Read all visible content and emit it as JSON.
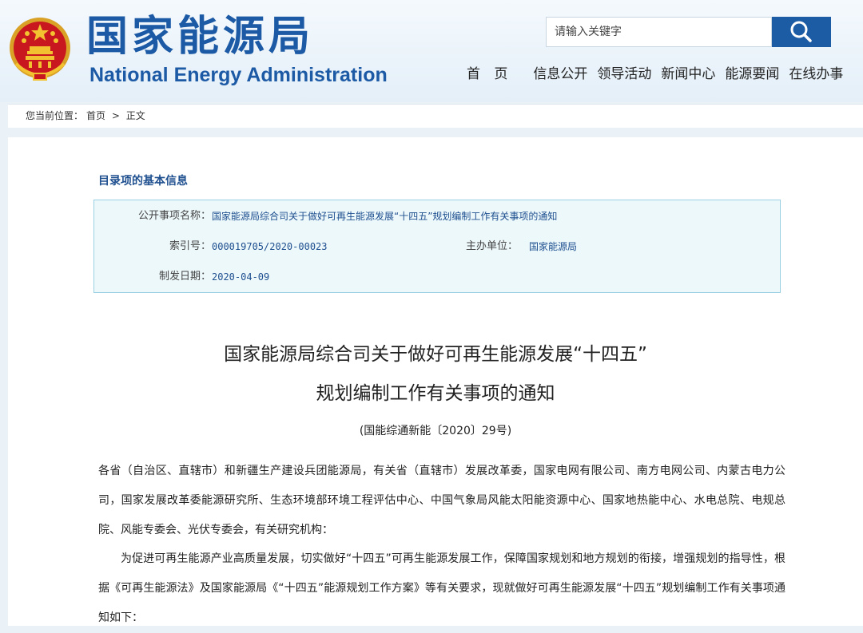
{
  "header": {
    "cn_name": "国家能源局",
    "en_name": "National Energy Administration",
    "brand_color": "#1d5aa5"
  },
  "search": {
    "placeholder": "请输入关键字",
    "icon": "search-icon"
  },
  "nav": {
    "home": "首 页",
    "items": [
      "信息公开",
      "领导活动",
      "新闻中心",
      "能源要闻",
      "在线办事"
    ]
  },
  "breadcrumb": {
    "prefix": "您当前位置：",
    "home": "首页",
    "separator": ">",
    "current": "正文"
  },
  "info": {
    "title": "目录项的基本信息",
    "item_label": "公开事项名称：",
    "item_value": "国家能源局综合司关于做好可再生能源发展“十四五”规划编制工作有关事项的通知",
    "index_label": "索引号：",
    "index_value": "000019705/2020-00023",
    "unit_label": "主办单位：",
    "unit_value": "国家能源局",
    "date_label": "制发日期：",
    "date_value": "2020-04-09"
  },
  "document": {
    "title_line1": "国家能源局综合司关于做好可再生能源发展“十四五”",
    "title_line2": "规划编制工作有关事项的通知",
    "doc_number": "(国能综通新能〔2020〕29号)",
    "recipients": "各省（自治区、直辖市）和新疆生产建设兵团能源局，有关省（直辖市）发展改革委，国家电网有限公司、南方电网公司、内蒙古电力公司，国家发展改革委能源研究所、生态环境部环境工程评估中心、中国气象局风能太阳能资源中心、国家地热能中心、水电总院、电规总院、风能专委会、光伏专委会，有关研究机构：",
    "intro": "为促进可再生能源产业高质量发展，切实做好“十四五”可再生能源发展工作，保障国家规划和地方规划的衔接，增强规划的指导性，根据《可再生能源法》及国家能源局《“十四五”能源规划工作方案》等有关要求，现就做好可再生能源发展“十四五”规划编制工作有关事项通知如下："
  }
}
